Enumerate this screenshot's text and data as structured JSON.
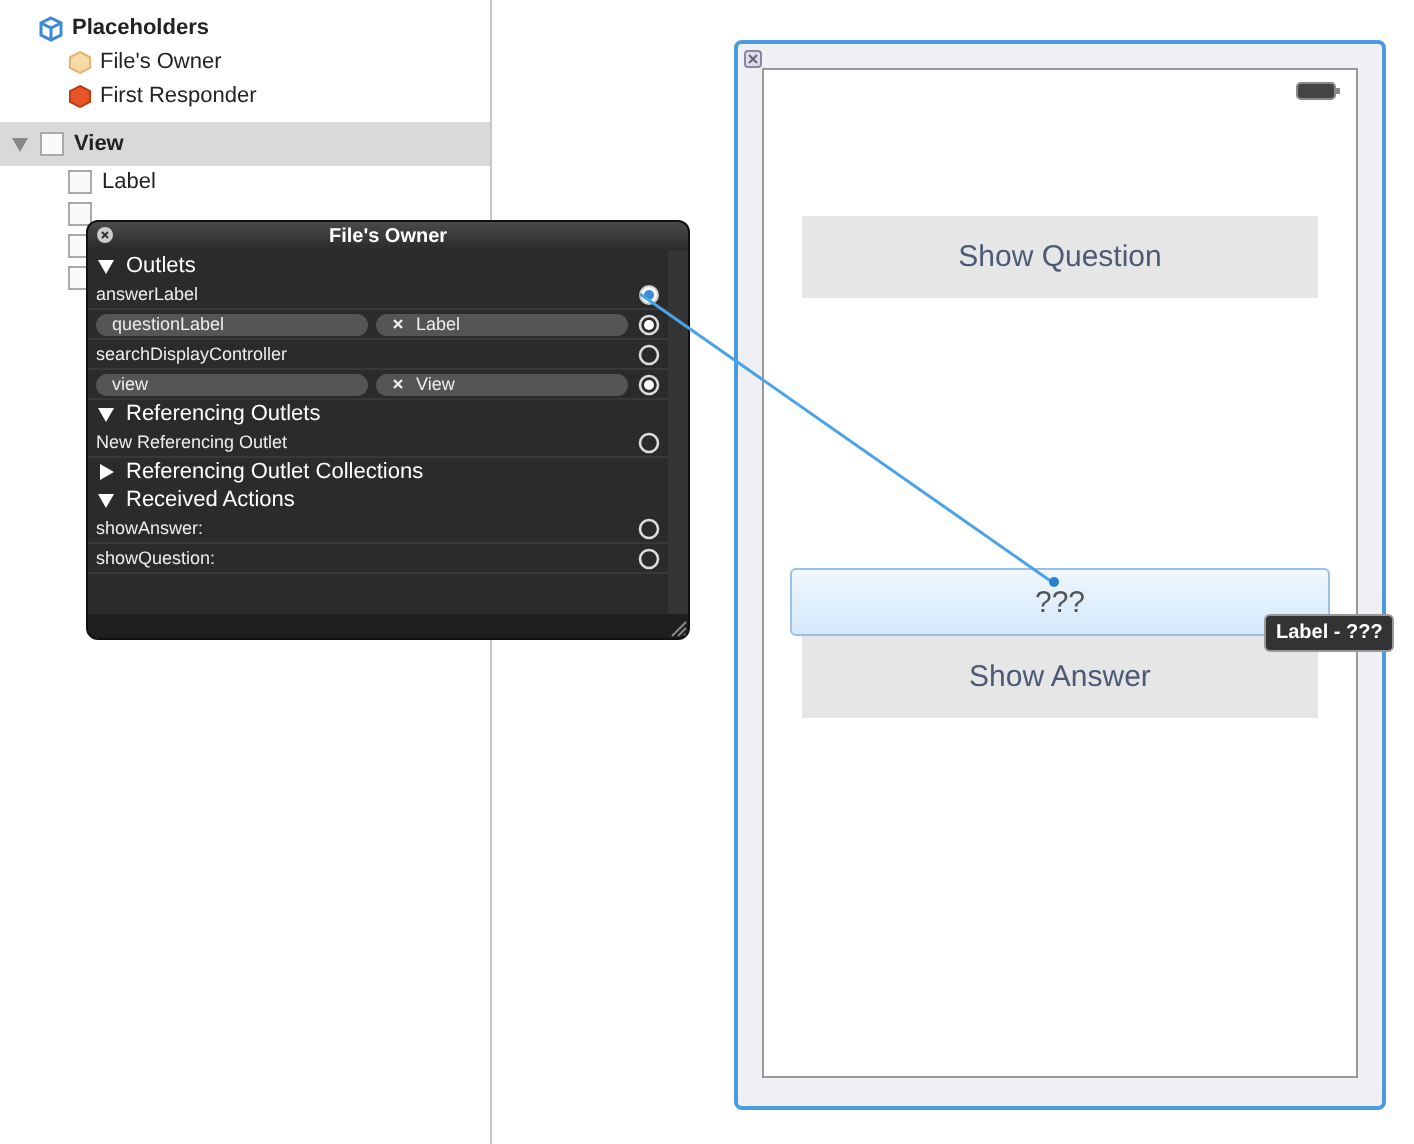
{
  "outline": {
    "placeholders": {
      "title": "Placeholders",
      "items": [
        {
          "label": "File's Owner",
          "kind": "owner"
        },
        {
          "label": "First Responder",
          "kind": "responder"
        }
      ]
    },
    "view": {
      "label": "View",
      "expanded": true,
      "selected": true,
      "children": [
        {
          "kind": "item",
          "label": "Label"
        },
        {
          "kind": "covered"
        },
        {
          "kind": "covered"
        },
        {
          "kind": "covered"
        }
      ]
    }
  },
  "connections_panel": {
    "title": "File's Owner",
    "rows": [
      {
        "kind": "section",
        "label": "Outlets",
        "expanded": true
      },
      {
        "kind": "outlet",
        "name": "answerLabel",
        "connected": false,
        "dragging": true
      },
      {
        "kind": "outlet",
        "name": "questionLabel",
        "target": "Label",
        "connected": true,
        "dragging": false
      },
      {
        "kind": "outlet",
        "name": "searchDisplayController",
        "connected": false,
        "dragging": false
      },
      {
        "kind": "outlet",
        "name": "view",
        "target": "View",
        "connected": true,
        "dragging": false
      },
      {
        "kind": "section",
        "label": "Referencing Outlets",
        "expanded": true
      },
      {
        "kind": "outlet",
        "name": "New Referencing Outlet",
        "connected": false,
        "dragging": false
      },
      {
        "kind": "section",
        "label": "Referencing Outlet Collections",
        "expanded": false
      },
      {
        "kind": "section",
        "label": "Received Actions",
        "expanded": true
      },
      {
        "kind": "outlet",
        "name": "showAnswer:",
        "connected": false,
        "dragging": false
      },
      {
        "kind": "outlet",
        "name": "showQuestion:",
        "connected": false,
        "dragging": false
      }
    ]
  },
  "phone": {
    "selected": true,
    "elements": [
      {
        "kind": "button",
        "label": "Show Question"
      },
      {
        "kind": "spacer"
      },
      {
        "kind": "label",
        "label": "???",
        "highlighted": true
      },
      {
        "kind": "button",
        "label": "Show Answer"
      }
    ]
  },
  "tooltip": "Label - ???"
}
